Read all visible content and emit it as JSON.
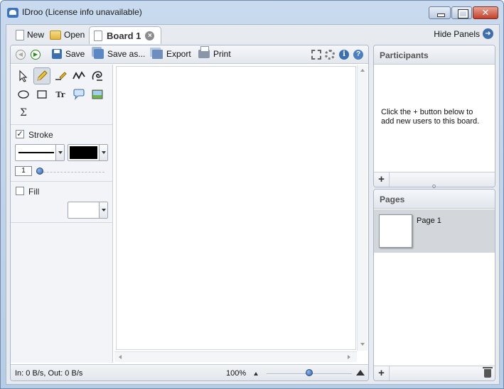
{
  "window": {
    "title": "IDroo (License info unavailable)",
    "close_glyph": "✕"
  },
  "tabbar": {
    "new_label": "New",
    "open_label": "Open",
    "board_tab_label": "Board 1",
    "tab_close_glyph": "×",
    "hide_panels_label": "Hide Panels",
    "hide_panels_glyph": "➜"
  },
  "toolbar": {
    "back_glyph": "◀",
    "forward_glyph": "▶",
    "save_label": "Save",
    "save_as_label": "Save as...",
    "export_label": "Export",
    "print_label": "Print",
    "info_glyph": "i",
    "help_glyph": "?"
  },
  "tools": {
    "icons": [
      "pointer-icon",
      "pencil-icon",
      "highlighter-icon",
      "freehand-line-icon",
      "spiral-icon",
      "ellipse-icon",
      "rectangle-icon",
      "text-icon",
      "callout-icon",
      "image-icon",
      "formula-icon"
    ],
    "text_glyph": "Tr",
    "formula_glyph": "Σ",
    "stroke_checked": true,
    "stroke_label": "Stroke",
    "stroke_width": "1",
    "fill_checked": false,
    "fill_label": "Fill",
    "stroke_color": "#000000",
    "fill_color": "#ffffff",
    "check_glyph": "✓"
  },
  "status": {
    "network": "In: 0 B/s, Out: 0 B/s",
    "zoom": "100%"
  },
  "participants": {
    "title": "Participants",
    "message": "Click the + button below to add new users to this board.",
    "add_glyph": "+"
  },
  "pages": {
    "title": "Pages",
    "items": [
      {
        "label": "Page 1"
      }
    ],
    "add_glyph": "+"
  },
  "colors": {
    "accent": "#3a6fb3",
    "forward_green": "#2d8a21",
    "close_red": "#c4402b"
  }
}
